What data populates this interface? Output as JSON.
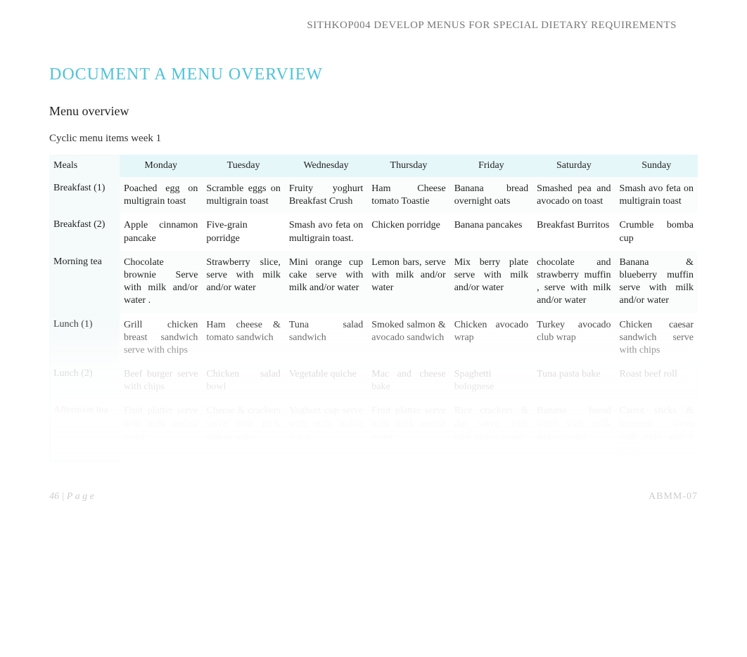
{
  "header": {
    "course_code": "SITHKOP004 DEVELOP MENUS FOR SPECIAL DIETARY REQUIREMENTS"
  },
  "title": "DOCUMENT A MENU OVERVIEW",
  "subtitle": "Menu overview",
  "subheading": "Cyclic menu items week 1",
  "table": {
    "columns": [
      "Meals",
      "Monday",
      "Tuesday",
      "Wednesday",
      "Thursday",
      "Friday",
      "Saturday",
      "Sunday"
    ],
    "rows": [
      {
        "meal": "Breakfast (1)",
        "cells": [
          "Poached egg on multigrain toast",
          "Scramble eggs on multigrain toast",
          "Fruity yoghurt Breakfast Crush",
          "Ham Cheese tomato Toastie",
          "Banana bread overnight oats",
          "Smashed pea and avocado on toast",
          "Smash avo feta on multigrain toast"
        ]
      },
      {
        "meal": "Breakfast (2)",
        "cells": [
          "Apple cinnamon pancake",
          "Five-grain porridge",
          "Smash avo feta on multigrain toast.",
          "Chicken porridge",
          "Banana pancakes",
          "Breakfast Burritos",
          "Crumble bomba cup"
        ]
      },
      {
        "meal": "Morning tea",
        "cells": [
          "Chocolate brownie Serve with milk and/or water .",
          "Strawberry slice, serve with milk and/or water",
          "Mini orange cup cake serve with milk and/or water",
          "Lemon bars, serve with milk and/or water",
          "Mix berry plate serve with milk and/or water",
          "chocolate and strawberry muffin , serve with milk and/or water",
          "Banana & blueberry muffin serve with milk and/or water"
        ]
      },
      {
        "meal": "Lunch (1)",
        "cells": [
          "Grill chicken breast sandwich serve with chips",
          "Ham cheese & tomato sandwich",
          "Tuna salad sandwich",
          "Smoked salmon & avocado sandwich",
          "Chicken avocado wrap",
          "Turkey avocado club wrap",
          "Chicken caesar sandwich serve with chips"
        ]
      },
      {
        "meal": "Lunch (2)",
        "cells": [
          "Beef burger serve with chips",
          "Chicken salad bowl",
          "Vegetable quiche",
          "Mac and cheese bake",
          "Spaghetti bolognese",
          "Tuna pasta bake",
          "Roast beef roll"
        ]
      },
      {
        "meal": "Afternoon tea",
        "cells": [
          "Fruit platter serve with milk and/or water",
          "Cheese & crackers serve with milk and/or water",
          "Yoghurt cup serve with milk and/or water",
          "Fruit platter serve with milk and/or water",
          "Rice crackers & dip serve with milk and/or water",
          "Banana bread serve with milk and/or water",
          "Carrot sticks & hummus serve with milk and/or water"
        ]
      }
    ]
  },
  "footer": {
    "left": "46 | P a g e",
    "right": "ABMM-07"
  }
}
